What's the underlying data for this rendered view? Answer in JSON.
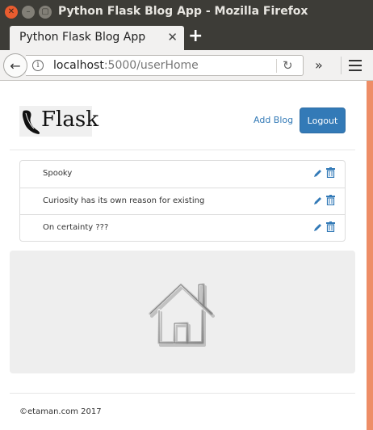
{
  "window": {
    "title": "Python Flask Blog App - Mozilla Firefox",
    "close_glyph": "✕",
    "minimize_glyph": "–",
    "maximize_glyph": "▢"
  },
  "tab": {
    "title": "Python Flask Blog App",
    "close_glyph": "✕",
    "new_tab_glyph": "+"
  },
  "navbar": {
    "url_host": "localhost",
    "url_rest": ":5000/userHome",
    "back_glyph": "←",
    "info_glyph": "i",
    "reload_glyph": "↻",
    "overflow_glyph": "»"
  },
  "header": {
    "logo_text": "Flask",
    "add_blog_label": "Add Blog",
    "logout_label": "Logout"
  },
  "blogs": [
    {
      "title": "Spooky"
    },
    {
      "title": "Curiosity has its own reason for existing"
    },
    {
      "title": "On certainty ???"
    }
  ],
  "footer": {
    "text": "©etaman.com 2017"
  },
  "colors": {
    "accent": "#337ab7",
    "titlebar": "#3d3c37",
    "scrollbar": "#ee8d66",
    "jumbotron": "#eeeeee"
  },
  "icons": [
    "back-arrow-icon",
    "info-icon",
    "reload-icon",
    "overflow-icon",
    "hamburger-menu-icon",
    "edit-pencil-icon",
    "trash-icon",
    "house-icon"
  ]
}
